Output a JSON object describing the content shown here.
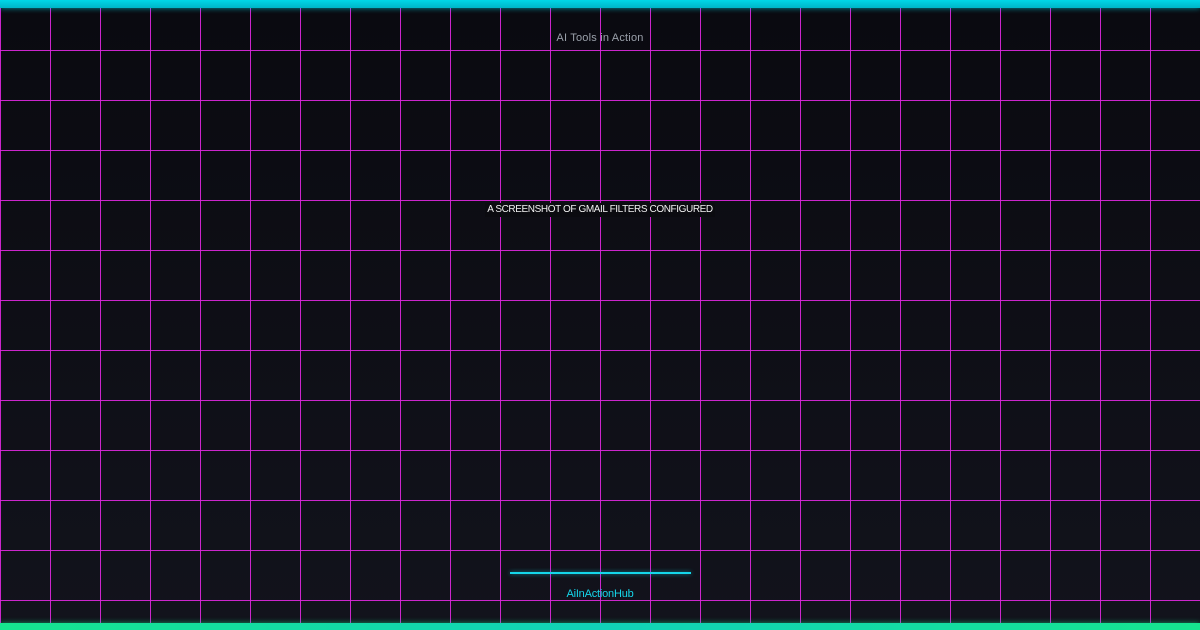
{
  "brand": {
    "title": "AI Tools in Action",
    "footer": "AiInActionHub"
  },
  "caption": {
    "text": "A SCREENSHOT OF GMAIL FILTERS CONFIGURED"
  },
  "theme": {
    "background": "#0d0d14",
    "grid_color": "#e028e0",
    "accent_top": "#00d7e8",
    "accent_bottom": "#16e58f",
    "accent_cyan": "#15d6ea"
  }
}
